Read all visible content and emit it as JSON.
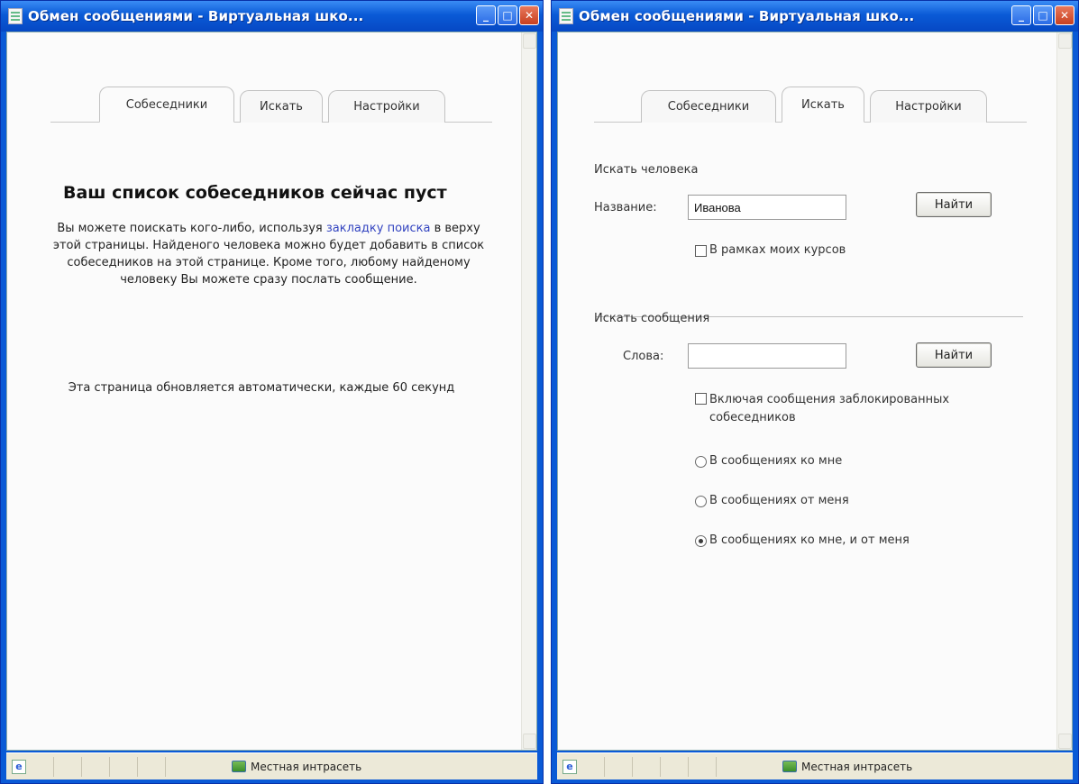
{
  "left_window": {
    "title": "Обмен сообщениями - Виртуальная шко...",
    "tabs": [
      "Собеседники",
      "Искать",
      "Настройки"
    ],
    "active_tab": "Собеседники",
    "heading": "Ваш список собеседников сейчас пуст",
    "para_before_link": "Вы можете поискать кого-либо, используя ",
    "link_text": "закладку поиска",
    "para_after_link": " в верху этой страницы. Найденого человека можно будет добавить в список собеседников на этой странице. Кроме того, любому найденому человеку Вы можете сразу послать сообщение.",
    "refresh_note": "Эта страница обновляется автоматически, каждые 60 секунд",
    "status_zone": "Местная интрасеть"
  },
  "right_window": {
    "title": "Обмен сообщениями - Виртуальная шко...",
    "tabs": [
      "Собеседники",
      "Искать",
      "Настройки"
    ],
    "active_tab": "Искать",
    "person_section": "Искать человека",
    "name_label": "Название:",
    "name_value": "Иванова",
    "find_button": "Найти",
    "my_courses_checkbox": "В рамках моих курсов",
    "messages_section": "Искать сообщения",
    "words_label": "Слова:",
    "words_value": "",
    "blocked_checkbox": "Включая сообщения заблокированных собеседников",
    "radio_to_me": "В сообщениях ко мне",
    "radio_from_me": "В сообщениях от меня",
    "radio_both": "В сообщениях ко мне, и от меня",
    "status_zone": "Местная интрасеть"
  }
}
